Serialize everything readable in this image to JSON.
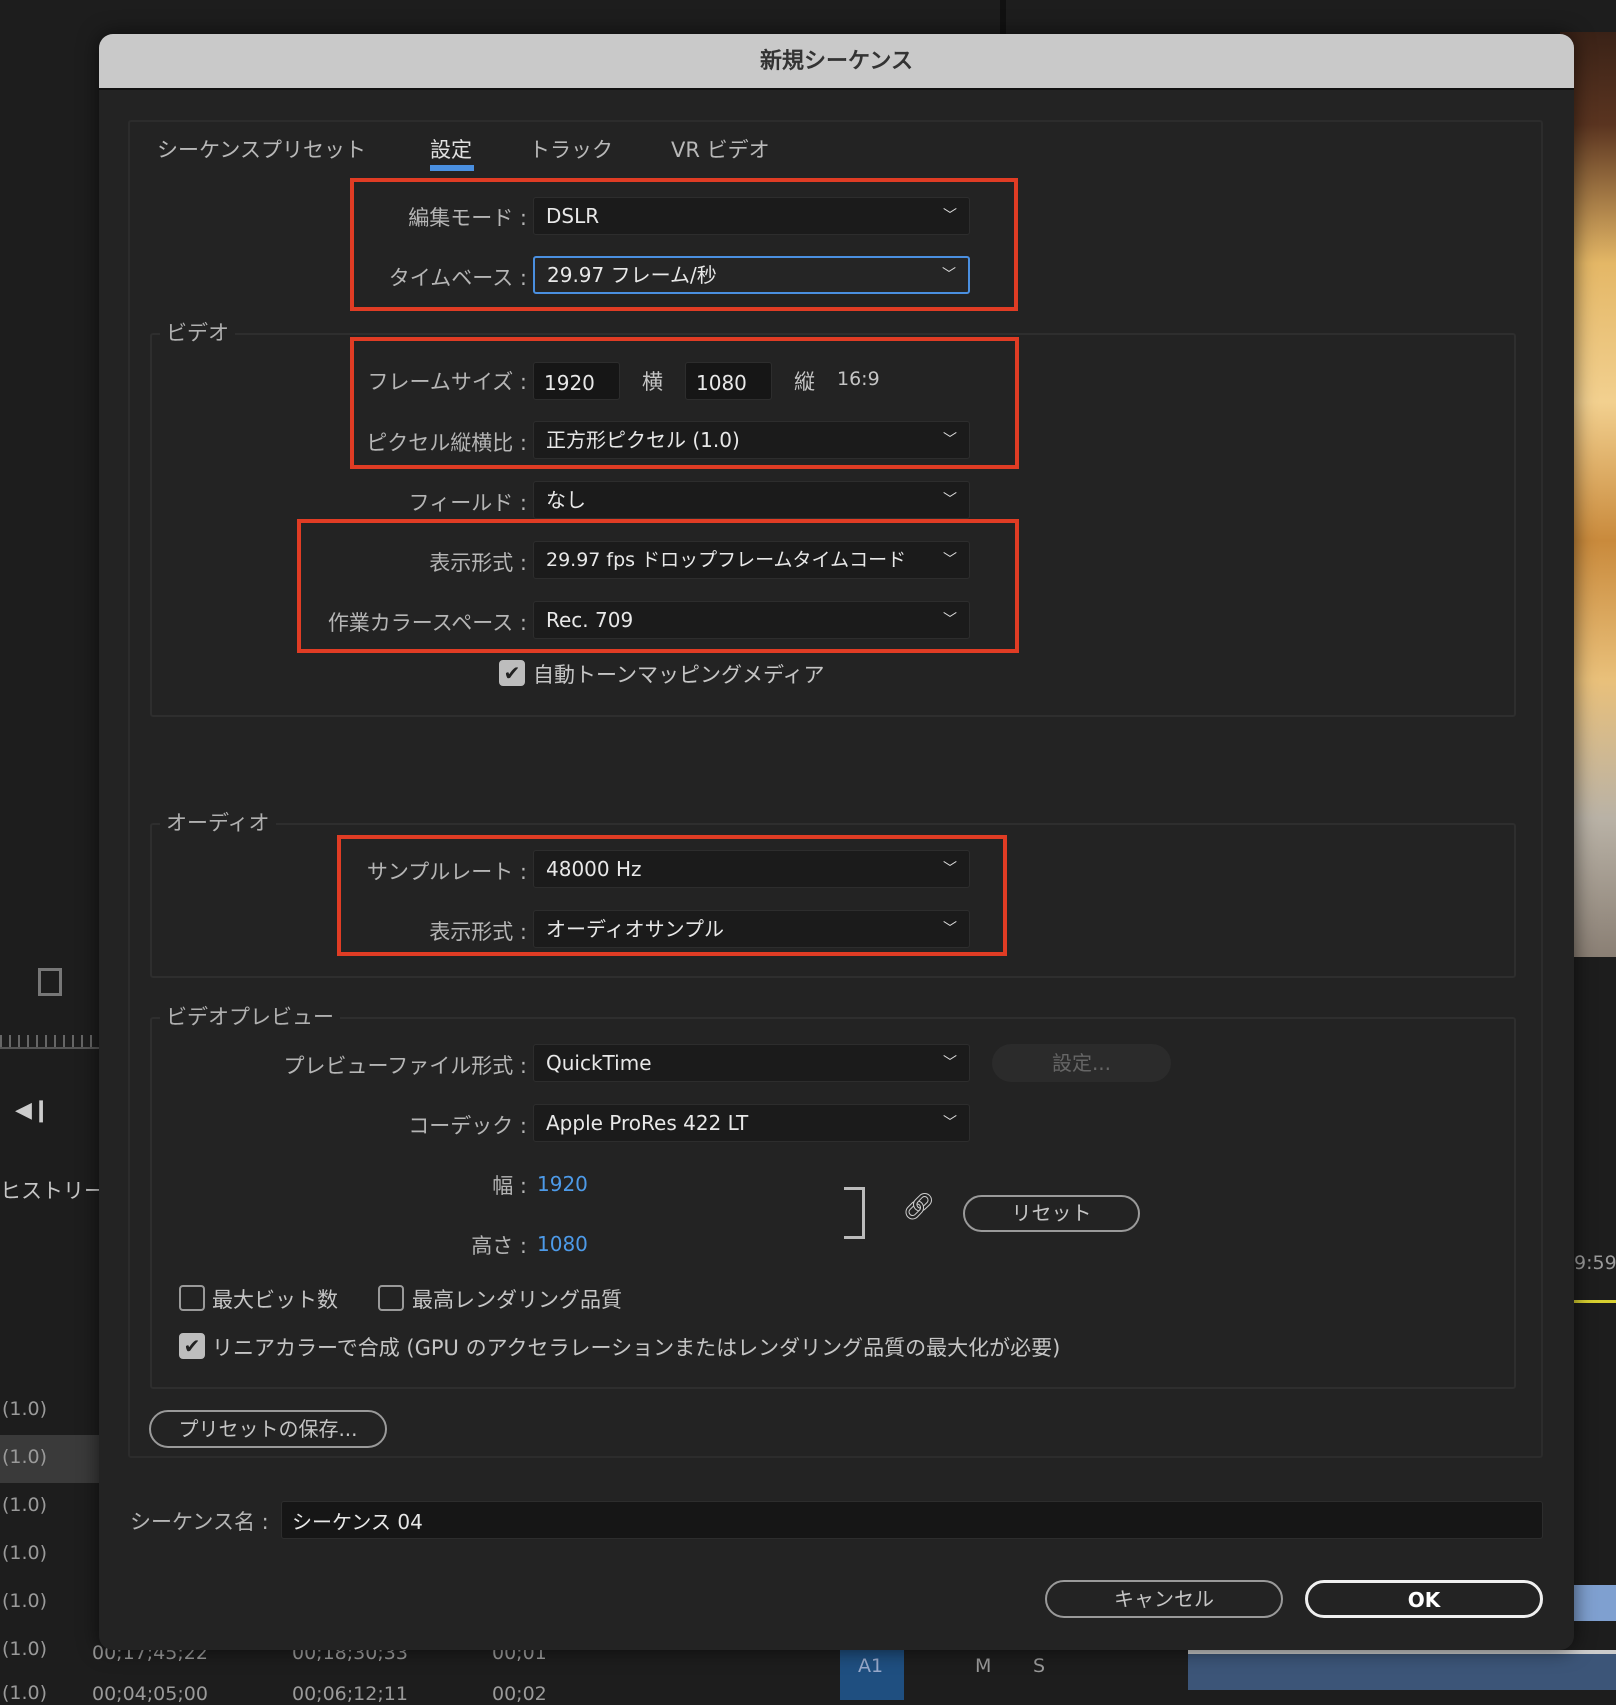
{
  "background": {
    "history_label": "ヒストリー",
    "rows": [
      "(1.0)",
      "(1.0)",
      "(1.0)",
      "(1.0)",
      "(1.0)",
      "(1.0)",
      "(1.0)"
    ],
    "timecodes": [
      "00;17;45;22",
      "00;18;30;33",
      "00;01",
      "00;04;05;00",
      "00;06;12;11",
      "00;02"
    ],
    "time_right": "9:59",
    "track": {
      "a1": "A1",
      "m": "M",
      "s": "S"
    }
  },
  "dialog": {
    "title": "新規シーケンス",
    "tabs": [
      "シーケンスプリセット",
      "設定",
      "トラック",
      "VR ビデオ"
    ],
    "active_tab": "設定",
    "edit_mode": {
      "label": "編集モード :",
      "value": "DSLR"
    },
    "timebase": {
      "label": "タイムベース :",
      "value": "29.97  フレーム/秒"
    },
    "video": {
      "legend": "ビデオ",
      "frame_size": {
        "label": "フレームサイズ :",
        "width": "1920",
        "h_label": "横",
        "height": "1080",
        "v_label": "縦",
        "ratio": "16:9"
      },
      "pixel_aspect": {
        "label": "ピクセル縦横比 :",
        "value": "正方形ピクセル (1.0)"
      },
      "fields": {
        "label": "フィールド :",
        "value": "なし"
      },
      "display_format": {
        "label": "表示形式 :",
        "value": "29.97 fps ドロップフレームタイムコード"
      },
      "color_space": {
        "label": "作業カラースペース :",
        "value": "Rec. 709"
      },
      "auto_tone": {
        "label": "自動トーンマッピングメディア",
        "checked": true
      }
    },
    "audio": {
      "legend": "オーディオ",
      "sample_rate": {
        "label": "サンプルレート :",
        "value": "48000 Hz"
      },
      "display_format": {
        "label": "表示形式 :",
        "value": "オーディオサンプル"
      }
    },
    "preview": {
      "legend": "ビデオプレビュー",
      "file_format": {
        "label": "プレビューファイル形式 :",
        "value": "QuickTime"
      },
      "settings_button": "設定...",
      "codec": {
        "label": "コーデック :",
        "value": "Apple ProRes 422 LT"
      },
      "width": {
        "label": "幅 :",
        "value": "1920"
      },
      "height": {
        "label": "高さ :",
        "value": "1080"
      },
      "reset_button": "リセット",
      "max_bit_depth": {
        "label": "最大ビット数",
        "checked": false
      },
      "max_render_quality": {
        "label": "最高レンダリング品質",
        "checked": false
      },
      "linear_color": {
        "label": "リニアカラーで合成 (GPU のアクセラレーションまたはレンダリング品質の最大化が必要)",
        "checked": true
      }
    },
    "save_preset_button": "プリセットの保存...",
    "sequence_name": {
      "label": "シーケンス名 :",
      "value": "シーケンス 04"
    },
    "cancel_button": "キャンセル",
    "ok_button": "OK",
    "highlight_color": "#e03c24",
    "accent_color": "#4a8fe0"
  }
}
